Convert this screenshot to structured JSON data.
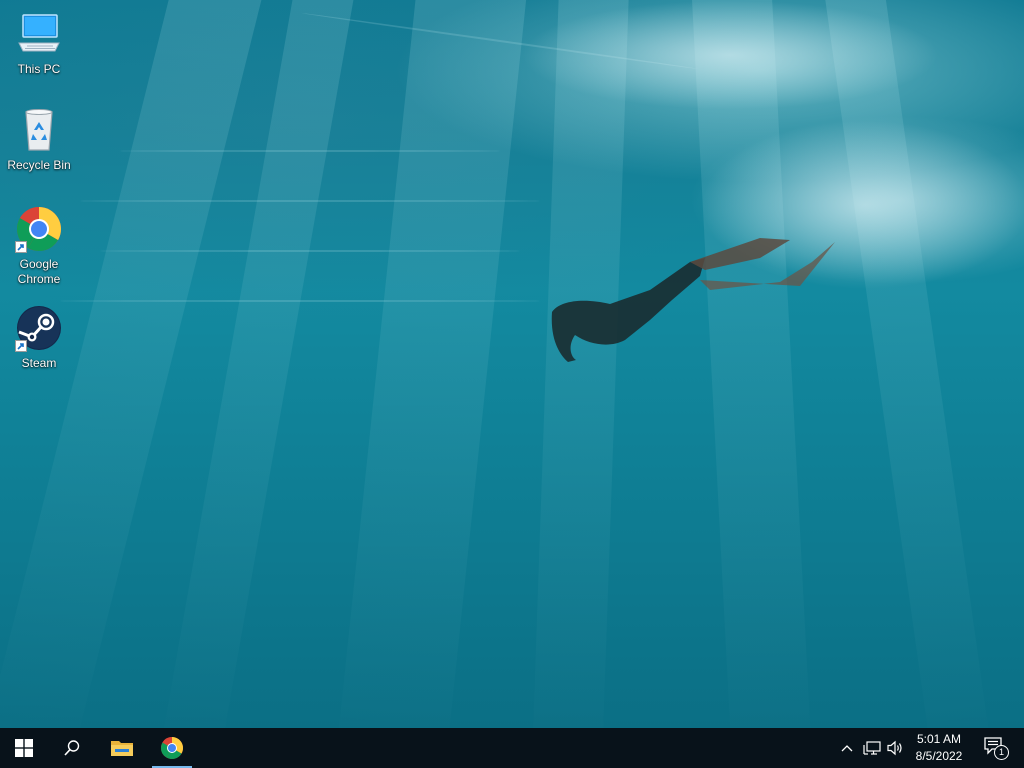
{
  "desktop": {
    "wallpaper": "underwater-freediver",
    "icons": [
      {
        "label": "This PC",
        "icon": "computer-monitor-icon"
      },
      {
        "label": "Recycle Bin",
        "icon": "recycle-bin-icon"
      },
      {
        "label": "Google\nChrome",
        "icon": "chrome-icon",
        "shortcut": true
      },
      {
        "label": "Steam",
        "icon": "steam-icon",
        "shortcut": true
      }
    ]
  },
  "taskbar": {
    "start_icon": "windows-logo-icon",
    "search_icon": "search-icon",
    "pinned": [
      {
        "name": "File Explorer",
        "icon": "folder-icon",
        "active": false
      },
      {
        "name": "Google Chrome",
        "icon": "chrome-icon",
        "active": true
      }
    ],
    "tray": {
      "overflow_icon": "chevron-up-icon",
      "network_icon": "network-icon",
      "volume_icon": "speaker-icon",
      "time": "5:01 AM",
      "date": "8/5/2022",
      "notifications_icon": "action-center-icon",
      "notification_count": "1"
    }
  },
  "colors": {
    "taskbar_bg": "#08121a",
    "active_indicator": "#76b9ed",
    "water": "#138aa0"
  }
}
